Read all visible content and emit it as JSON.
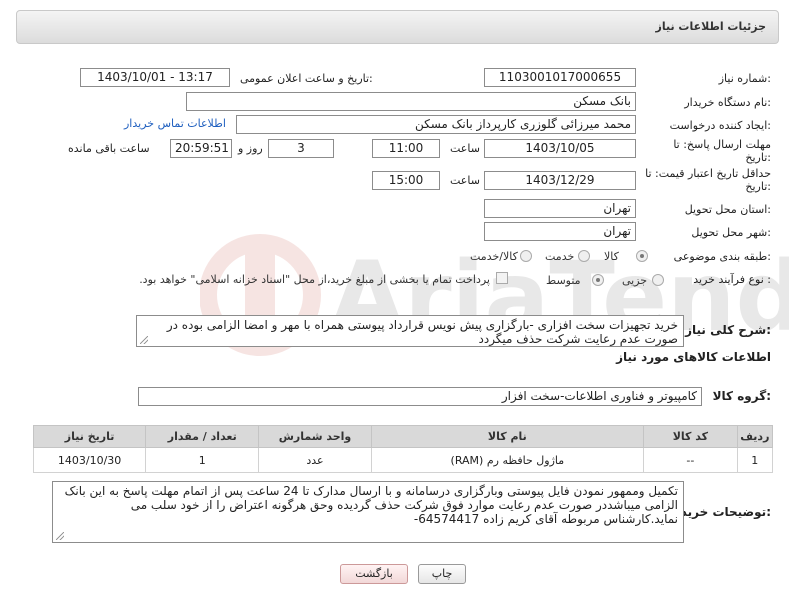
{
  "header": {
    "title": "جزئیات اطلاعات نیاز"
  },
  "fields": {
    "need_number_label": "شماره نیاز:",
    "need_number": "1103001017000655",
    "announce_label": "تاریخ و ساعت اعلان عمومی:",
    "announce_value": "1403/10/01 - 13:17",
    "buyer_org_label": "نام دستگاه خریدار:",
    "buyer_org": "بانک مسکن",
    "requester_label": "ایجاد کننده درخواست:",
    "requester": "محمد میرزائی گلوزری کارپرداز بانک مسکن",
    "contact_link": "اطلاعات تماس خریدار",
    "reply_deadline_label_1": "مهلت ارسال پاسخ: تا",
    "reply_deadline_label_2": "تاریخ:",
    "reply_date": "1403/10/05",
    "time_label": "ساعت",
    "reply_time": "11:00",
    "days_value": "3",
    "days_label": "روز و",
    "remaining_time": "20:59:51",
    "remaining_label": "ساعت باقی مانده",
    "price_validity_label_1": "حداقل تاریخ اعتبار قیمت: تا",
    "price_validity_label_2": "تاریخ:",
    "price_date": "1403/12/29",
    "price_time": "15:00",
    "province_label": "استان محل تحویل:",
    "province": "تهران",
    "city_label": "شهر محل تحویل:",
    "city": "تهران",
    "category_label": "طبقه بندی موضوعی:",
    "category_options": [
      "کالا",
      "خدمت",
      "کالا/خدمت"
    ],
    "process_label": "نوع فرآیند خرید :",
    "process_options": [
      "جزیی",
      "متوسط"
    ],
    "payment_note": "پرداخت تمام یا بخشی از مبلغ خرید،از محل \"اسناد خزانه اسلامی\" خواهد بود."
  },
  "description": {
    "label": "شرح کلی نیاز:",
    "text": "خرید تجهیزات سخت افزاری -بارگزاری پیش نویس قرارداد پیوستی همراه با مهر و امضا الزامی بوده در صورت عدم رعایت شرکت حذف میگردد"
  },
  "goods": {
    "section_title": "اطلاعات کالاهای مورد نیاز",
    "group_label": "گروه کالا:",
    "group_value": "کامپیوتر و فناوری اطلاعات-سخت افزار",
    "columns": [
      "ردیف",
      "کد کالا",
      "نام کالا",
      "واحد شمارش",
      "تعداد / مقدار",
      "تاریخ نیاز"
    ],
    "rows": [
      [
        "1",
        "--",
        "ماژول حافظه رم (RAM)",
        "عدد",
        "1",
        "1403/10/30"
      ]
    ]
  },
  "buyer_notes": {
    "label": "توضیحات خریدار:",
    "text": "تکمیل وممهور نمودن فایل پیوستی وبارگزاری درسامانه و با ارسال مدارک تا 24 ساعت پس از اتمام مهلت پاسخ به این بانک الزامی میباشددر صورت عدم رعایت موارد فوق شرکت حذف گردیده وحق هرگونه اعتراض را از خود سلب می نماید.کارشناس مربوطه آقای کریم زاده 64574417-"
  },
  "buttons": {
    "print": "چاپ",
    "back": "بازگشت"
  },
  "colors": {
    "link": "#1f5fbf",
    "header_bg": "#dcdcdc",
    "table_header": "#d9d9d9"
  }
}
